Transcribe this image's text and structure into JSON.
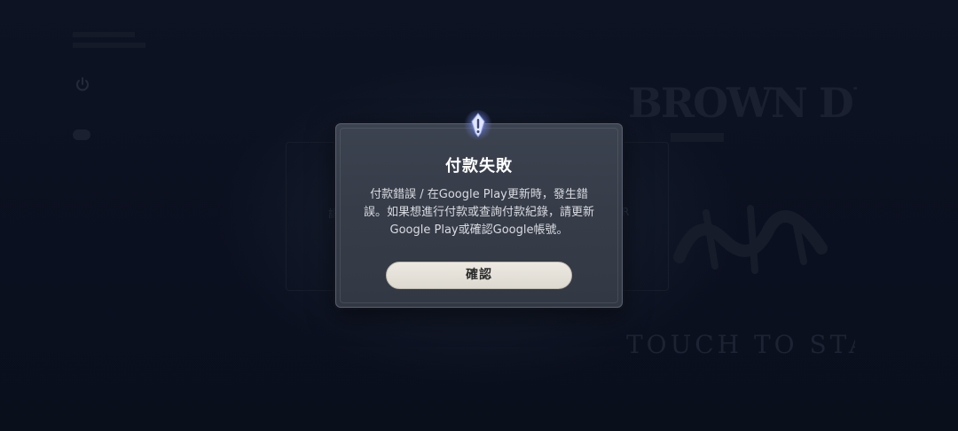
{
  "dialog": {
    "title": "付款失敗",
    "message_lines": [
      "付款錯誤 / 在Google Play更新時，發生錯",
      "誤。如果想進行付款或查詢付款紀錄，請更新",
      "Google Play或確認Google帳號。"
    ],
    "confirm_label": "確認",
    "icon": "alert-exclamation-icon"
  },
  "background": {
    "game_logo_text": "BROWN DUST II",
    "prompt_text": "TOUCH TO START",
    "left_side_letter": "請",
    "right_side_letter": "R"
  },
  "colors": {
    "backdrop": "#0c1220",
    "dialog_bg": "#363c48",
    "dialog_border": "#5a6070",
    "title": "#ffffff",
    "message": "#d9dbe0",
    "button_bg": "#e4e0d8",
    "button_text": "#2a2a2a",
    "icon_glow": "#8aa0ff"
  }
}
